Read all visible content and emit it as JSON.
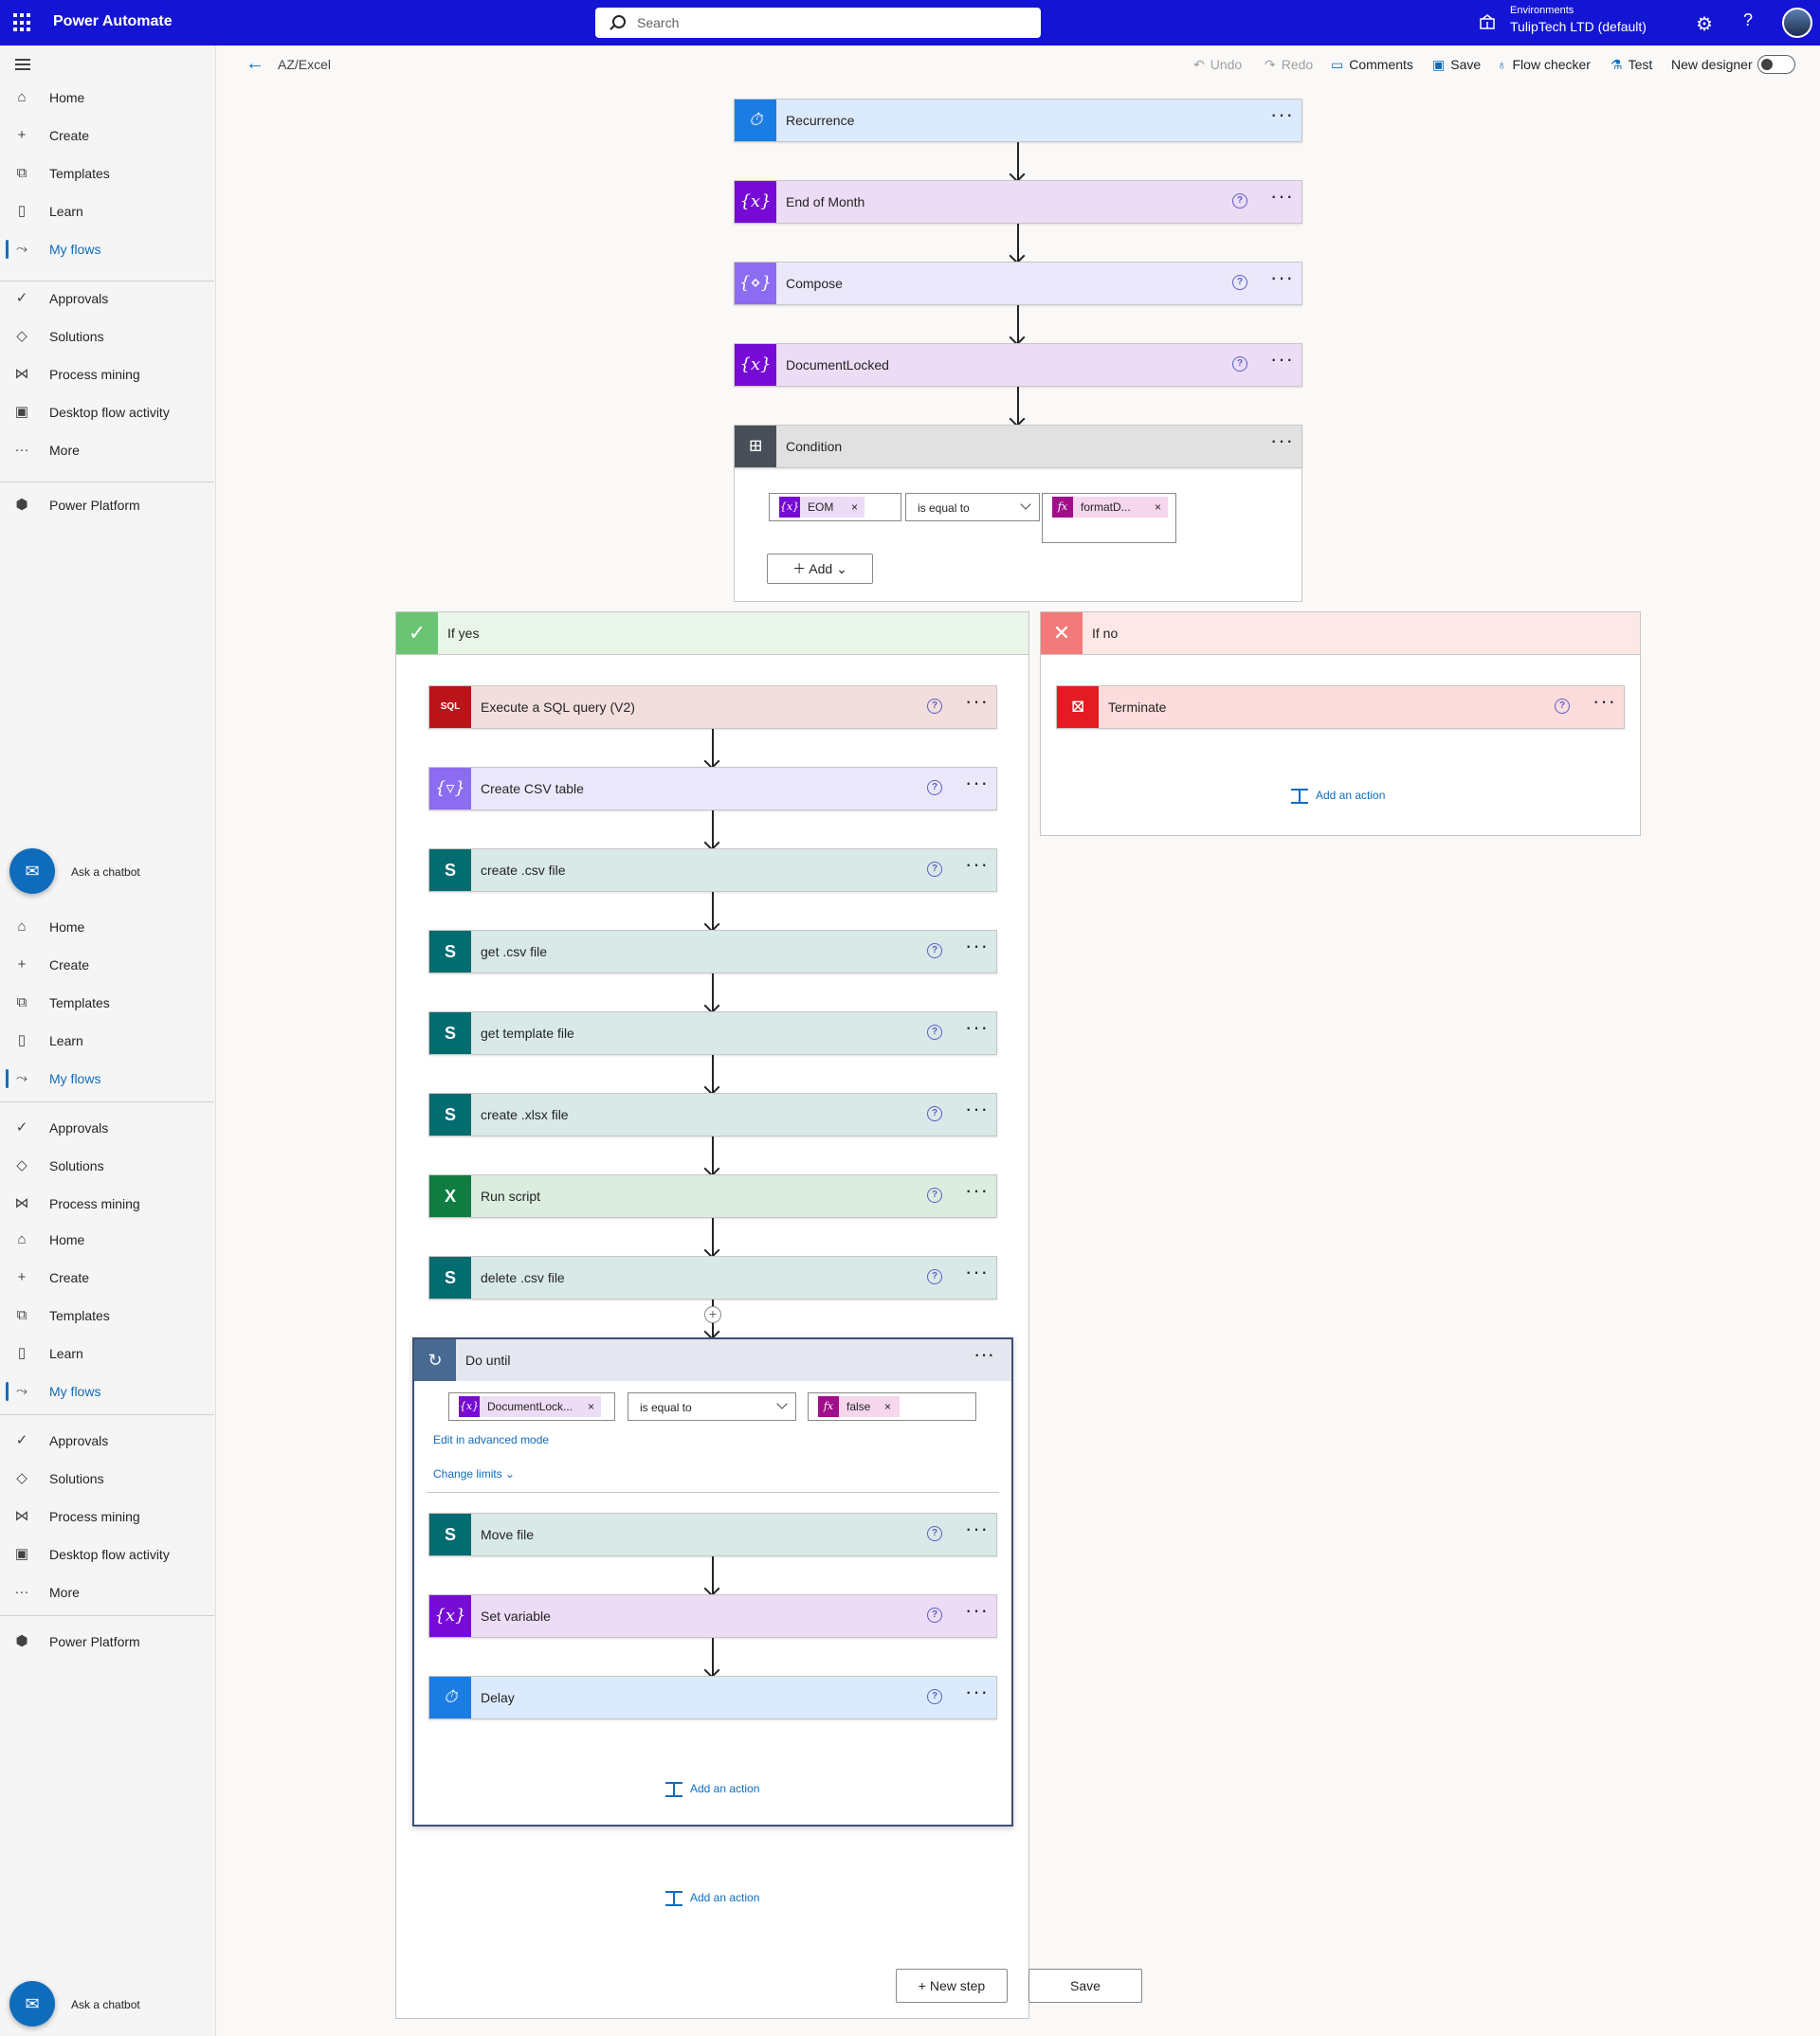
{
  "app": {
    "title": "Power Automate",
    "search_placeholder": "Search",
    "environment_label": "Environments",
    "environment_name": "TulipTech LTD (default)"
  },
  "sidebar": {
    "groups": [
      {
        "items": [
          {
            "label": "Home",
            "icon": "home-icon"
          },
          {
            "label": "Create",
            "icon": "plus-icon"
          },
          {
            "label": "Templates",
            "icon": "templates-icon"
          },
          {
            "label": "Learn",
            "icon": "book-icon"
          },
          {
            "label": "My flows",
            "icon": "flows-icon",
            "active": true
          }
        ]
      },
      {
        "items": [
          {
            "label": "Approvals",
            "icon": "approvals-icon"
          },
          {
            "label": "Solutions",
            "icon": "solutions-icon"
          },
          {
            "label": "Process mining",
            "icon": "process-mining-icon"
          },
          {
            "label": "Desktop flow activity",
            "icon": "desktop-flow-icon"
          },
          {
            "label": "More",
            "icon": "more-icon"
          }
        ]
      },
      {
        "items": [
          {
            "label": "Power Platform",
            "icon": "power-platform-icon"
          }
        ]
      }
    ],
    "chatbot_label": "Ask a chatbot",
    "repeat_a": [
      "Home",
      "Create",
      "Templates",
      "Learn",
      "My flows"
    ],
    "repeat_b": [
      "Approvals",
      "Solutions",
      "Process mining"
    ],
    "repeat_c": [
      "Home",
      "Create",
      "Templates",
      "Learn",
      "My flows"
    ],
    "repeat_d": [
      "Approvals",
      "Solutions",
      "Process mining",
      "Desktop flow activity",
      "More"
    ],
    "repeat_e": [
      "Power Platform"
    ]
  },
  "commandbar": {
    "flow_name": "AZ/Excel",
    "undo": "Undo",
    "redo": "Redo",
    "comments": "Comments",
    "save": "Save",
    "flow_checker": "Flow checker",
    "test": "Test",
    "new_designer": "New designer"
  },
  "flow": {
    "steps": [
      {
        "title": "Recurrence",
        "color": "#1b7ce4",
        "icon": "clock-icon"
      },
      {
        "title": "End of Month",
        "color": "#770bd6",
        "icon": "variable-icon"
      },
      {
        "title": "Compose",
        "color": "#8c6cf0",
        "icon": "compose-icon"
      },
      {
        "title": "DocumentLocked",
        "color": "#770bd6",
        "icon": "variable-icon"
      }
    ],
    "condition": {
      "title": "Condition",
      "left_token": "EOM",
      "operator": "is equal to",
      "right_token": "formatD...",
      "add_label": "Add"
    },
    "if_yes": {
      "label": "If yes",
      "steps": [
        {
          "title": "Execute a SQL query (V2)",
          "icon": "sql-icon"
        },
        {
          "title": "Create CSV table",
          "icon": "data-operation-icon"
        },
        {
          "title": "create .csv file",
          "icon": "sharepoint-icon"
        },
        {
          "title": "get .csv file",
          "icon": "sharepoint-icon"
        },
        {
          "title": "get template file",
          "icon": "sharepoint-icon"
        },
        {
          "title": "create .xlsx file",
          "icon": "sharepoint-icon"
        },
        {
          "title": "Run script",
          "icon": "excel-icon"
        },
        {
          "title": "delete .csv file",
          "icon": "sharepoint-icon"
        }
      ],
      "do_until": {
        "title": "Do until",
        "left_token": "DocumentLock...",
        "operator": "is equal to",
        "right_token": "false",
        "advanced_link": "Edit in advanced mode",
        "limits_link": "Change limits",
        "steps": [
          {
            "title": "Move file",
            "icon": "sharepoint-icon"
          },
          {
            "title": "Set variable",
            "icon": "variable-icon"
          },
          {
            "title": "Delay",
            "icon": "clock-icon"
          }
        ],
        "add_action": "Add an action"
      },
      "add_action": "Add an action"
    },
    "if_no": {
      "label": "If no",
      "steps": [
        {
          "title": "Terminate",
          "icon": "terminate-icon"
        }
      ],
      "add_action": "Add an action"
    },
    "new_step": "+ New step",
    "save": "Save"
  }
}
